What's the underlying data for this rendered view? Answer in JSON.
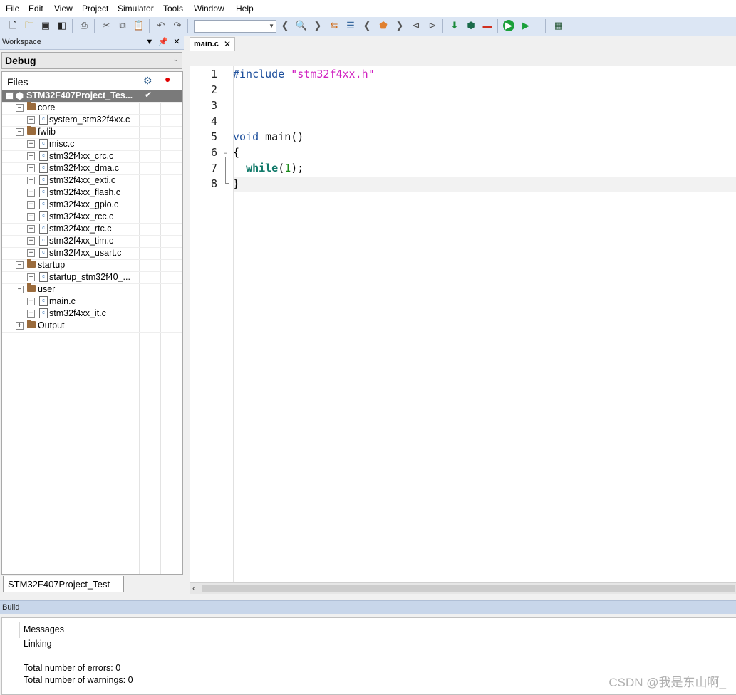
{
  "menu": [
    "File",
    "Edit",
    "View",
    "Project",
    "Simulator",
    "Tools",
    "Window",
    "Help"
  ],
  "toolbar": {
    "icons": [
      "new-file-icon",
      "open-folder-icon",
      "save-icon",
      "save-all-icon",
      "print-icon",
      "cut-icon",
      "copy-icon",
      "paste-icon",
      "undo-icon",
      "redo-icon",
      "nav-back-icon",
      "find-icon",
      "nav-forward-icon",
      "toggle-icon",
      "list-icon",
      "back-icon",
      "bookmark-icon",
      "forward-icon",
      "prev-bookmark-icon",
      "next-bookmark-icon",
      "download-icon",
      "build-icon",
      "stop-icon",
      "debug-run-icon",
      "run-icon",
      "options-icon"
    ],
    "search_value": ""
  },
  "workspace": {
    "title": "Workspace",
    "config": "Debug",
    "files_header": "Files",
    "project_name": "STM32F407Project_Tes...",
    "tab": "STM32F407Project_Test",
    "items": [
      {
        "label": "core",
        "type": "folder",
        "level": 1,
        "expanded": true
      },
      {
        "label": "system_stm32f4xx.c",
        "type": "file",
        "level": 2
      },
      {
        "label": "fwlib",
        "type": "folder",
        "level": 1,
        "expanded": true
      },
      {
        "label": "misc.c",
        "type": "file",
        "level": 2
      },
      {
        "label": "stm32f4xx_crc.c",
        "type": "file",
        "level": 2
      },
      {
        "label": "stm32f4xx_dma.c",
        "type": "file",
        "level": 2
      },
      {
        "label": "stm32f4xx_exti.c",
        "type": "file",
        "level": 2
      },
      {
        "label": "stm32f4xx_flash.c",
        "type": "file",
        "level": 2
      },
      {
        "label": "stm32f4xx_gpio.c",
        "type": "file",
        "level": 2
      },
      {
        "label": "stm32f4xx_rcc.c",
        "type": "file",
        "level": 2
      },
      {
        "label": "stm32f4xx_rtc.c",
        "type": "file",
        "level": 2
      },
      {
        "label": "stm32f4xx_tim.c",
        "type": "file",
        "level": 2
      },
      {
        "label": "stm32f4xx_usart.c",
        "type": "file",
        "level": 2
      },
      {
        "label": "startup",
        "type": "folder",
        "level": 1,
        "expanded": true
      },
      {
        "label": "startup_stm32f40_...",
        "type": "file",
        "level": 2
      },
      {
        "label": "user",
        "type": "folder",
        "level": 1,
        "expanded": true
      },
      {
        "label": "main.c",
        "type": "file",
        "level": 2
      },
      {
        "label": "stm32f4xx_it.c",
        "type": "file",
        "level": 2
      },
      {
        "label": "Output",
        "type": "folder",
        "level": 1,
        "expanded": false
      }
    ]
  },
  "editor": {
    "tab": "main.c",
    "line_numbers": [
      "1",
      "2",
      "3",
      "4",
      "5",
      "6",
      "7",
      "8"
    ],
    "code": {
      "l1_directive": "#include",
      "l1_string": "\"stm32f4xx.h\"",
      "l5_kw": "void",
      "l5_rest": " main()",
      "l6": "{",
      "l7_kw": "while",
      "l7_open": "(",
      "l7_num": "1",
      "l7_close": ");",
      "l8": "}"
    }
  },
  "build": {
    "title": "Build",
    "messages_header": "Messages",
    "lines": [
      "Linking",
      "",
      "Total number of errors: 0",
      "Total number of warnings: 0"
    ]
  },
  "watermark": "CSDN @我是东山啊_"
}
